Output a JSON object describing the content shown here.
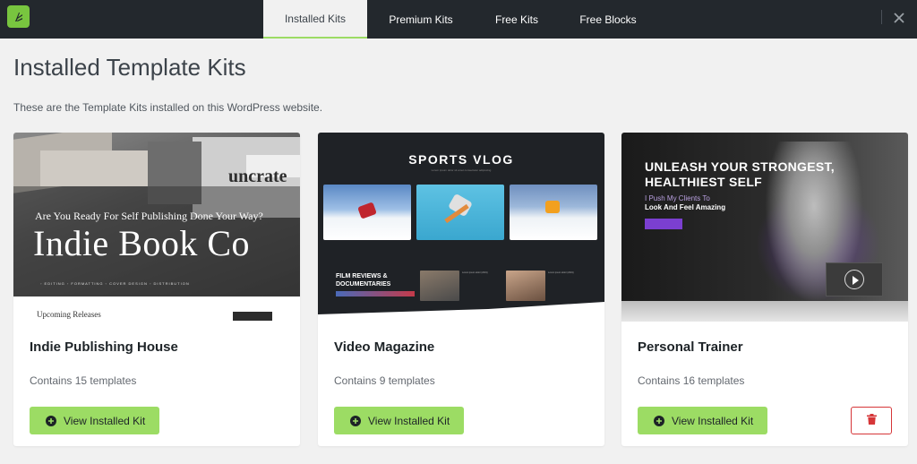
{
  "tabs": [
    {
      "label": "Installed Kits",
      "active": true
    },
    {
      "label": "Premium Kits",
      "active": false
    },
    {
      "label": "Free Kits",
      "active": false
    },
    {
      "label": "Free Blocks",
      "active": false
    }
  ],
  "page": {
    "title": "Installed Template Kits",
    "description": "These are the Template Kits installed on this WordPress website."
  },
  "kits": [
    {
      "name": "Indie Publishing House",
      "count_text": "Contains 15 templates",
      "button_label": "View Installed Kit",
      "thumb": {
        "heading": "Are You Ready For Self Publishing Done Your Way?",
        "title": "Indie Book Co",
        "nav": "◦ EDITING   ◦ FORMATTING   ◦ COVER DESIGN   ◦ DISTRIBUTION",
        "upcoming": "Upcoming Releases"
      }
    },
    {
      "name": "Video Magazine",
      "count_text": "Contains 9 templates",
      "button_label": "View Installed Kit",
      "thumb": {
        "title": "SPORTS VLOG",
        "subtitle": "Lorem ipsum dolor sit amet consectetur adipiscing",
        "film_line1": "FILM REVIEWS &",
        "film_line2": "DOCUMENTARIES",
        "item_text": "Lorem ipsum dolor (2019)"
      }
    },
    {
      "name": "Personal Trainer",
      "count_text": "Contains 16 templates",
      "button_label": "View Installed Kit",
      "thumb": {
        "heading_line1": "UNLEASH YOUR STRONGEST,",
        "heading_line2": "HEALTHIEST SELF",
        "sub1": "I Push My Clients To",
        "sub2": "Look And Feel Amazing"
      }
    }
  ],
  "icons": {
    "logo": "elementor-kit-logo-icon",
    "close": "close-icon",
    "add": "plus-circle-icon",
    "delete": "trash-icon"
  },
  "colors": {
    "topbar": "#23282d",
    "accent_green": "#9cdc64",
    "logo_green": "#78c53f",
    "delete_red": "#d63638",
    "background": "#f1f1f1"
  }
}
